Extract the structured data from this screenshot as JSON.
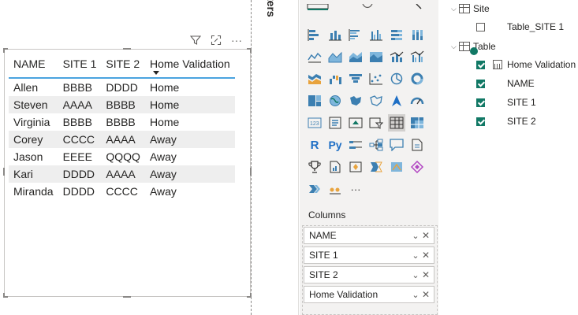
{
  "canvas": {
    "header_icons": [
      "filter-icon",
      "focus-mode-icon",
      "more-options-icon"
    ],
    "more_label": "···",
    "table": {
      "columns": [
        "NAME",
        "SITE 1",
        "SITE 2",
        "Home Validation"
      ],
      "rows": [
        [
          "Allen",
          "BBBB",
          "DDDD",
          "Home"
        ],
        [
          "Steven",
          "AAAA",
          "BBBB",
          "Home"
        ],
        [
          "Virginia",
          "BBBB",
          "BBBB",
          "Home"
        ],
        [
          "Corey",
          "CCCC",
          "AAAA",
          "Away"
        ],
        [
          "Jason",
          "EEEE",
          "QQQQ",
          "Away"
        ],
        [
          "Kari",
          "DDDD",
          "AAAA",
          "Away"
        ],
        [
          "Miranda",
          "DDDD",
          "CCCC",
          "Away"
        ]
      ],
      "header_accent": "#4aa3df"
    }
  },
  "filters_pane": {
    "label": "ters"
  },
  "visualizations": {
    "more_label": "···",
    "columns_label": "Columns",
    "wells": [
      {
        "label": "NAME"
      },
      {
        "label": "SITE 1"
      },
      {
        "label": "SITE 2"
      },
      {
        "label": "Home Validation"
      }
    ],
    "r_label": "R",
    "py_label": "Py"
  },
  "fields": {
    "tables": [
      {
        "name": "Site",
        "fields": [
          {
            "name": "Table_SITE 1",
            "checked": false
          }
        ]
      },
      {
        "name": "Table",
        "fields": [
          {
            "name": "Home Validation",
            "checked": true,
            "type": "calculated"
          },
          {
            "name": "NAME",
            "checked": true
          },
          {
            "name": "SITE 1",
            "checked": true
          },
          {
            "name": "SITE 2",
            "checked": true
          }
        ]
      }
    ]
  },
  "colors": {
    "check_green": "#117865",
    "pane_bg": "#f3f2f1"
  }
}
